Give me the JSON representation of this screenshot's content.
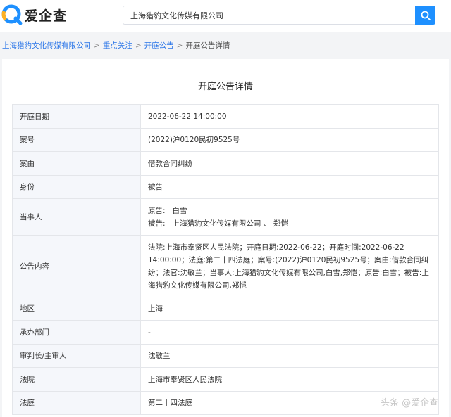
{
  "brand": {
    "name": "爱企查",
    "accent": "#1e90ff"
  },
  "search": {
    "value": "上海猎豹文化传媒有限公司"
  },
  "breadcrumb": {
    "links": [
      "上海猎豹文化传媒有限公司",
      "重点关注",
      "开庭公告"
    ],
    "current": "开庭公告详情",
    "separator": ">"
  },
  "page_title": "开庭公告详情",
  "fields": {
    "date": {
      "label": "开庭日期",
      "value": "2022-06-22 14:00:00"
    },
    "case_no": {
      "label": "案号",
      "value": "(2022)沪0120民初9525号"
    },
    "cause": {
      "label": "案由",
      "value": "借款合同纠纷"
    },
    "identity": {
      "label": "身份",
      "value": "被告"
    },
    "parties": {
      "label": "当事人",
      "plaintiff_role": "原告:",
      "plaintiff": "白雪",
      "defendant_role": "被告:",
      "defendant": "上海猎豹文化传媒有限公司 、 郑恺"
    },
    "content": {
      "label": "公告内容",
      "value": "法院:上海市奉贤区人民法院；开庭日期:2022-06-22；开庭时间:2022-06-22 14:00:00；法庭:第二十四法庭；案号:(2022)沪0120民初9525号；案由:借款合同纠纷；法官:沈敏兰；当事人:上海猎豹文化传媒有限公司,白雪,郑恺；原告:白雪；被告:上海猎豹文化传媒有限公司,郑恺"
    },
    "region": {
      "label": "地区",
      "value": "上海"
    },
    "department": {
      "label": "承办部门",
      "value": "-"
    },
    "judge": {
      "label": "审判长/主审人",
      "value": "沈敏兰"
    },
    "court": {
      "label": "法院",
      "value": "上海市奉贤区人民法院"
    },
    "courtroom": {
      "label": "法庭",
      "value": "第二十四法庭"
    }
  },
  "watermark": "头条 @爱企查"
}
